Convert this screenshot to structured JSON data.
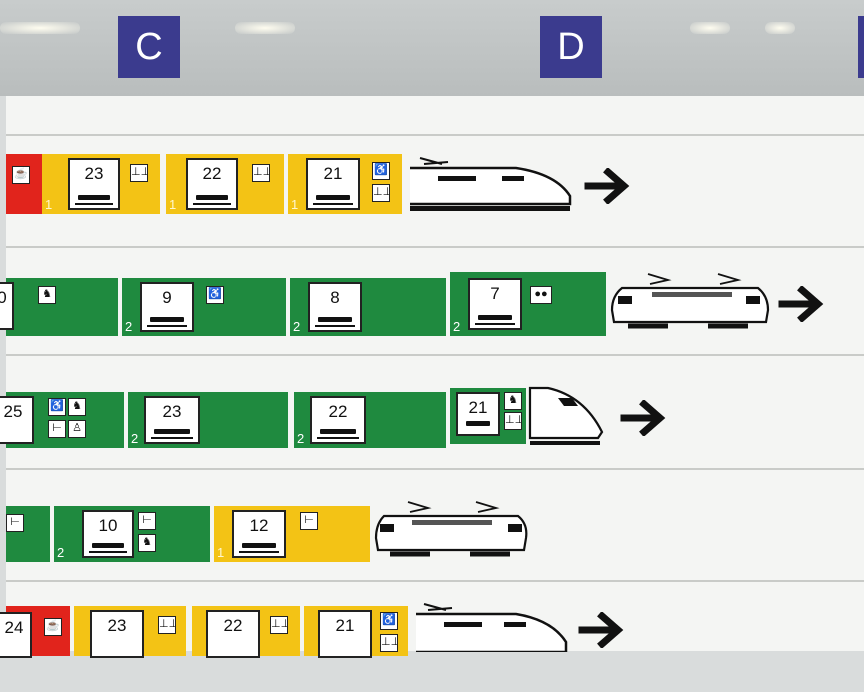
{
  "sectors": [
    {
      "label": "C"
    },
    {
      "label": "D"
    }
  ],
  "rows": [
    {
      "cars": [
        {
          "type": "rest",
          "number": ""
        },
        {
          "type": "first",
          "number": "23",
          "class": "1",
          "icons": [
            "couchette-icon"
          ]
        },
        {
          "type": "first",
          "number": "22",
          "class": "1",
          "icons": [
            "couchette-icon"
          ]
        },
        {
          "type": "first",
          "number": "21",
          "class": "1",
          "icons": [
            "wheelchair-icon",
            "couchette-icon"
          ]
        }
      ],
      "engine": "high-speed-nose",
      "direction": "right"
    },
    {
      "cars": [
        {
          "type": "second",
          "number": "0",
          "class": "",
          "icons": [
            "family-icon"
          ]
        },
        {
          "type": "second",
          "number": "9",
          "class": "2",
          "icons": [
            "wheelchair-icon"
          ]
        },
        {
          "type": "second",
          "number": "8",
          "class": "2",
          "icons": []
        },
        {
          "type": "second",
          "number": "7",
          "class": "2",
          "icons": [
            "bicycle-icon"
          ]
        }
      ],
      "engine": "locomotive",
      "direction": "right"
    },
    {
      "cars": [
        {
          "type": "second",
          "number": "25",
          "class": "",
          "icons": [
            "wheelchair-icon",
            "family-icon",
            "bed-icon",
            "children-icon"
          ]
        },
        {
          "type": "second",
          "number": "23",
          "class": "2",
          "icons": []
        },
        {
          "type": "second",
          "number": "22",
          "class": "2",
          "icons": []
        },
        {
          "type": "second",
          "number": "21",
          "class": "2",
          "icons": [
            "stroller-icon",
            "couchette-icon"
          ]
        }
      ],
      "engine": "cab-car",
      "direction": "right"
    },
    {
      "cars": [
        {
          "type": "second",
          "number": "",
          "class": "",
          "icons": [
            "bed-icon"
          ]
        },
        {
          "type": "second",
          "number": "10",
          "class": "2",
          "icons": [
            "bed-icon",
            "family-icon"
          ]
        },
        {
          "type": "first",
          "number": "12",
          "class": "1",
          "icons": [
            "bed-icon"
          ]
        }
      ],
      "engine": "locomotive",
      "direction": "none"
    },
    {
      "cars": [
        {
          "type": "rest",
          "number": "24",
          "class": "",
          "icons": [
            "restaurant-icon"
          ]
        },
        {
          "type": "first",
          "number": "23",
          "class": "",
          "icons": [
            "couchette-icon"
          ]
        },
        {
          "type": "first",
          "number": "22",
          "class": "",
          "icons": [
            "couchette-icon"
          ]
        },
        {
          "type": "first",
          "number": "21",
          "class": "",
          "icons": [
            "wheelchair-icon",
            "couchette-icon"
          ]
        }
      ],
      "engine": "high-speed-nose",
      "direction": "right"
    }
  ],
  "colors": {
    "first_class": "#f3c315",
    "second_class": "#1f8a3f",
    "restaurant": "#e1241c",
    "sector_badge": "#3b3b8e"
  }
}
